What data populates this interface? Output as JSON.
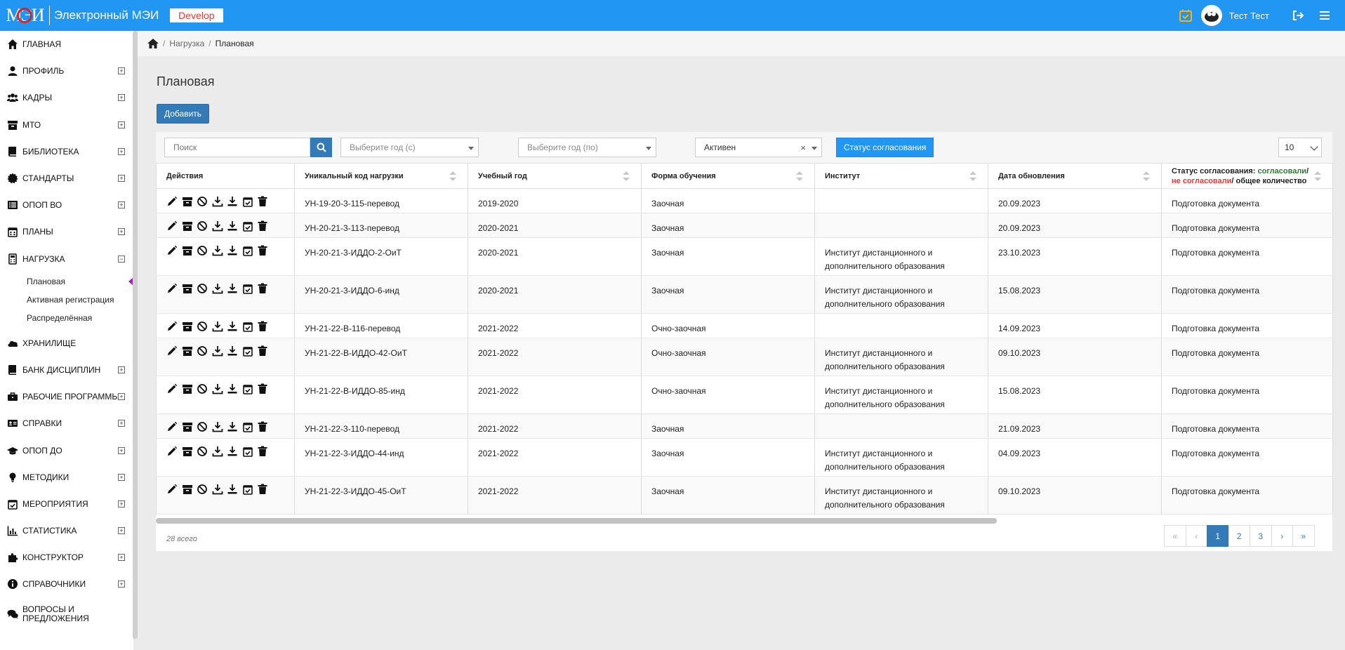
{
  "topbar": {
    "logo_text": "МЭИ",
    "app_title": "Электронный МЭИ",
    "env_badge": "Develop",
    "user_name": "Тест Тест"
  },
  "sidebar": {
    "items": [
      {
        "label": "ГЛАВНАЯ",
        "icon": "home-icon",
        "expandable": false
      },
      {
        "label": "ПРОФИЛЬ",
        "icon": "user-icon",
        "expandable": true
      },
      {
        "label": "КАДРЫ",
        "icon": "users-icon",
        "expandable": true
      },
      {
        "label": "МТО",
        "icon": "archive-icon",
        "expandable": true
      },
      {
        "label": "БИБЛИОТЕКА",
        "icon": "book-icon",
        "expandable": true
      },
      {
        "label": "СТАНДАРТЫ",
        "icon": "certificate-icon",
        "expandable": true
      },
      {
        "label": "ОПОП ВО",
        "icon": "list-icon",
        "expandable": true
      },
      {
        "label": "ПЛАНЫ",
        "icon": "calendar-icon",
        "expandable": true
      },
      {
        "label": "НАГРУЗКА",
        "icon": "calculator-icon",
        "expandable": true,
        "expanded": true
      },
      {
        "label": "ХРАНИЛИЩЕ",
        "icon": "cloud-icon",
        "expandable": false
      },
      {
        "label": "БАНК ДИСЦИПЛИН",
        "icon": "book-icon",
        "expandable": true
      },
      {
        "label": "РАБОЧИЕ ПРОГРАММЫ",
        "icon": "briefcase-icon",
        "expandable": true
      },
      {
        "label": "СПРАВКИ",
        "icon": "id-card-icon",
        "expandable": true
      },
      {
        "label": "ОПОП ДО",
        "icon": "graduation-cap-icon",
        "expandable": true
      },
      {
        "label": "МЕТОДИКИ",
        "icon": "lightbulb-icon",
        "expandable": true
      },
      {
        "label": "МЕРОПРИЯТИЯ",
        "icon": "calendar-check-icon",
        "expandable": true
      },
      {
        "label": "СТАТИСТИКА",
        "icon": "chart-icon",
        "expandable": true
      },
      {
        "label": "КОНСТРУКТОР",
        "icon": "puzzle-icon",
        "expandable": true
      },
      {
        "label": "СПРАВОЧНИКИ",
        "icon": "info-icon",
        "expandable": true
      },
      {
        "label": "ВОПРОСЫ И ПРЕДЛОЖЕНИЯ",
        "icon": "comments-icon",
        "expandable": false
      }
    ],
    "sub_items": [
      "Плановая",
      "Активная регистрация",
      "Распределённая"
    ]
  },
  "breadcrumb": {
    "items": [
      "Нагрузка",
      "Плановая"
    ]
  },
  "page": {
    "title": "Плановая",
    "add_label": "Добавить"
  },
  "filters": {
    "search_placeholder": "Поиск",
    "year_from_placeholder": "Выберите год (с)",
    "year_to_placeholder": "Выберите год (по)",
    "status_value": "Активен",
    "status_button": "Статус согласования",
    "page_size": "10"
  },
  "table": {
    "headers": [
      "Действия",
      "Уникальный код нагрузки",
      "Учебный год",
      "Форма обучения",
      "Институт",
      "Дата обновления"
    ],
    "status_header": {
      "prefix": "Статус согласования:",
      "agreed": "согласовали",
      "not_agreed": "не согласовали",
      "total": "общее количество"
    },
    "rows": [
      {
        "code": "УН-19-20-3-115-перевод",
        "year": "2019-2020",
        "form": "Заочная",
        "institute": "",
        "date": "20.09.2023",
        "status": "Подготовка документа"
      },
      {
        "code": "УН-20-21-3-113-перевод",
        "year": "2020-2021",
        "form": "Заочная",
        "institute": "",
        "date": "20.09.2023",
        "status": "Подготовка документа"
      },
      {
        "code": "УН-20-21-3-ИДДО-2-ОиТ",
        "year": "2020-2021",
        "form": "Заочная",
        "institute": "Институт дистанционного и дополнительного образования",
        "date": "23.10.2023",
        "status": "Подготовка документа"
      },
      {
        "code": "УН-20-21-3-ИДДО-6-инд",
        "year": "2020-2021",
        "form": "Заочная",
        "institute": "Институт дистанционного и дополнительного образования",
        "date": "15.08.2023",
        "status": "Подготовка документа"
      },
      {
        "code": "УН-21-22-В-116-перевод",
        "year": "2021-2022",
        "form": "Очно-заочная",
        "institute": "",
        "date": "14.09.2023",
        "status": "Подготовка документа"
      },
      {
        "code": "УН-21-22-В-ИДДО-42-ОиТ",
        "year": "2021-2022",
        "form": "Очно-заочная",
        "institute": "Институт дистанционного и дополнительного образования",
        "date": "09.10.2023",
        "status": "Подготовка документа"
      },
      {
        "code": "УН-21-22-В-ИДДО-85-инд",
        "year": "2021-2022",
        "form": "Очно-заочная",
        "institute": "Институт дистанционного и дополнительного образования",
        "date": "15.08.2023",
        "status": "Подготовка документа"
      },
      {
        "code": "УН-21-22-3-110-перевод",
        "year": "2021-2022",
        "form": "Заочная",
        "institute": "",
        "date": "21.09.2023",
        "status": "Подготовка документа"
      },
      {
        "code": "УН-21-22-3-ИДДО-44-инд",
        "year": "2021-2022",
        "form": "Заочная",
        "institute": "Институт дистанционного и дополнительного образования",
        "date": "04.09.2023",
        "status": "Подготовка документа"
      },
      {
        "code": "УН-21-22-3-ИДДО-45-ОиТ",
        "year": "2021-2022",
        "form": "Заочная",
        "institute": "Институт дистанционного и дополнительного образования",
        "date": "09.10.2023",
        "status": "Подготовка документа"
      }
    ]
  },
  "footer": {
    "total": "28 всего",
    "pages": [
      "1",
      "2",
      "3"
    ],
    "current_page": "1"
  },
  "colors": {
    "primary": "#2196f3",
    "button": "#337ab7",
    "agreed": "#2e7d32",
    "not_agreed": "#e53935",
    "env_badge": "#e53935",
    "active_marker": "#9c27b0"
  }
}
